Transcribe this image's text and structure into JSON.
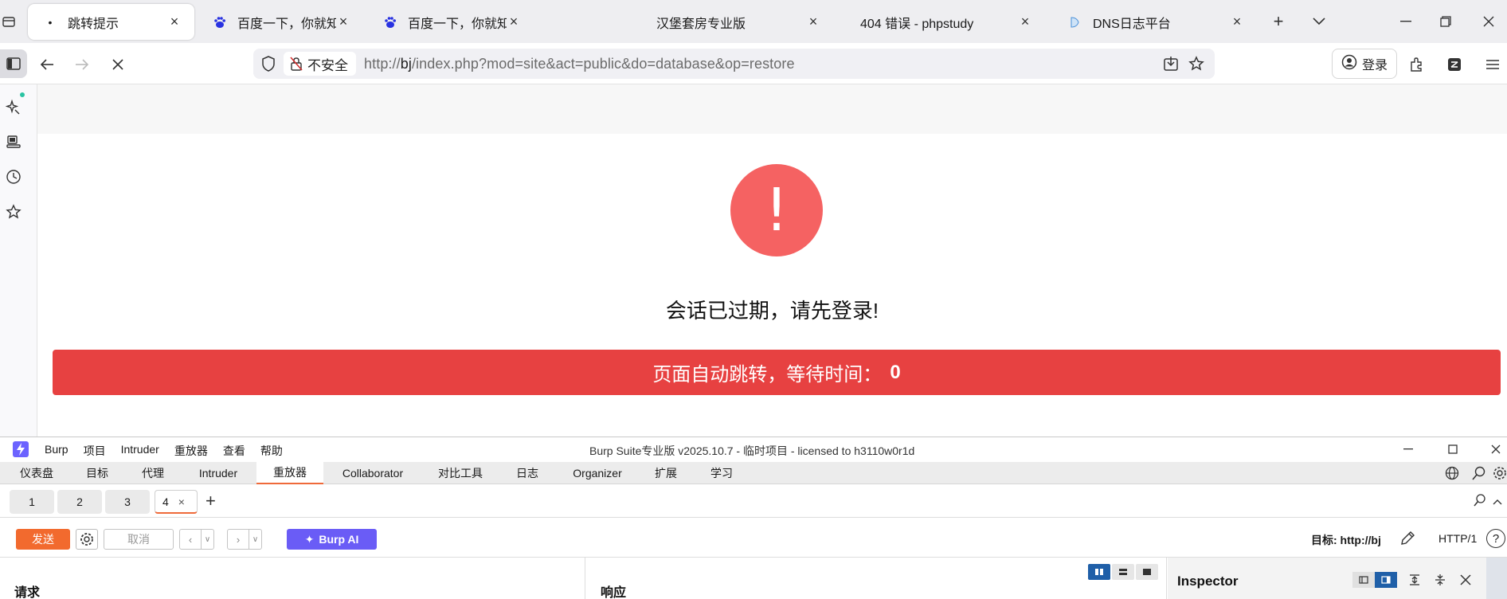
{
  "browser": {
    "tabs": [
      {
        "title": "跳转提示",
        "active": true,
        "favicon": "dot-icon"
      },
      {
        "title": "百度一下，你就知道",
        "active": false,
        "favicon": "baidu-paw-icon"
      },
      {
        "title": "百度一下，你就知道",
        "active": false,
        "favicon": "baidu-paw-icon"
      },
      {
        "title": "汉堡套房专业版",
        "active": false,
        "favicon": "none"
      },
      {
        "title": "404 错误 - phpstudy",
        "active": false,
        "favicon": "none"
      },
      {
        "title": "DNS日志平台",
        "active": false,
        "favicon": "dns-icon"
      }
    ],
    "security_label": "不安全",
    "url_prefix": "http://",
    "url_host": "bj",
    "url_path": "/index.php?mod=site&act=public&do=database&op=restore",
    "login_label": "登录"
  },
  "page": {
    "alert_symbol": "!",
    "message": "会话已过期，请先登录!",
    "redirect_text": "页面自动跳转，等待时间：",
    "redirect_seconds": "0"
  },
  "burp": {
    "menu": [
      "Burp",
      "项目",
      "Intruder",
      "重放器",
      "查看",
      "帮助"
    ],
    "window_title": "Burp Suite专业版  v2025.10.7 - 临时项目 - licensed to h3110w0r1d",
    "tools": [
      "仪表盘",
      "目标",
      "代理",
      "Intruder",
      "重放器",
      "Collaborator",
      "对比工具",
      "日志",
      "Organizer",
      "扩展",
      "学习"
    ],
    "active_tool": "重放器",
    "subtabs": [
      "1",
      "2",
      "3",
      "4"
    ],
    "active_subtab": "4",
    "send_label": "发送",
    "cancel_label": "取消",
    "ai_label": "Burp AI",
    "target_label": "目标: http://bj",
    "protocol_label": "HTTP/1",
    "request_title": "请求",
    "response_title": "响应",
    "inspector_title": "Inspector"
  },
  "colors": {
    "alert_red": "#f56262",
    "redirect_bar": "#e74141",
    "burp_orange": "#f26a2e",
    "burp_ai_purple": "#6a5cf6",
    "selected_blue": "#1f5fa8"
  }
}
